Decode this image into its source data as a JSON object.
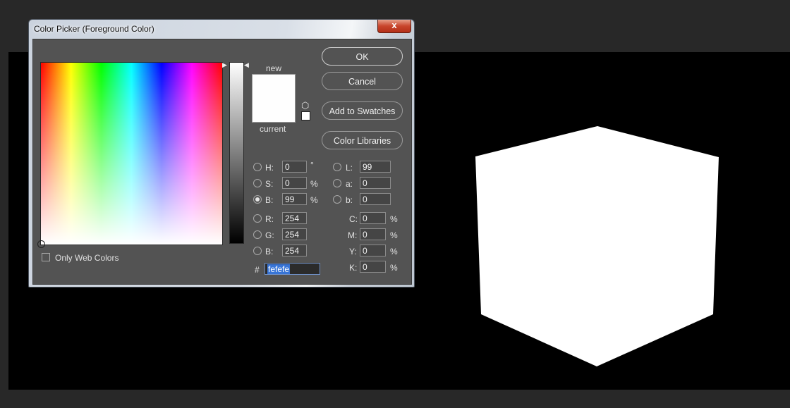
{
  "dialog": {
    "title": "Color Picker (Foreground Color)",
    "close_label": "x"
  },
  "preview": {
    "new_label": "new",
    "current_label": "current",
    "new_color": "#fefefe",
    "current_color": "#fefefe"
  },
  "buttons": {
    "ok": "OK",
    "cancel": "Cancel",
    "add_to_swatches": "Add to Swatches",
    "color_libraries": "Color Libraries"
  },
  "hsb": {
    "h": {
      "label": "H:",
      "value": "0",
      "unit": "°"
    },
    "s": {
      "label": "S:",
      "value": "0",
      "unit": "%"
    },
    "b": {
      "label": "B:",
      "value": "99",
      "unit": "%"
    }
  },
  "rgb": {
    "r": {
      "label": "R:",
      "value": "254"
    },
    "g": {
      "label": "G:",
      "value": "254"
    },
    "b": {
      "label": "B:",
      "value": "254"
    }
  },
  "lab": {
    "l": {
      "label": "L:",
      "value": "99"
    },
    "a": {
      "label": "a:",
      "value": "0"
    },
    "b": {
      "label": "b:",
      "value": "0"
    }
  },
  "cmyk": {
    "c": {
      "label": "C:",
      "value": "0",
      "unit": "%"
    },
    "m": {
      "label": "M:",
      "value": "0",
      "unit": "%"
    },
    "y": {
      "label": "Y:",
      "value": "0",
      "unit": "%"
    },
    "k": {
      "label": "K:",
      "value": "0",
      "unit": "%"
    }
  },
  "hex": {
    "label": "#",
    "value": "fefefe"
  },
  "only_web_colors": {
    "label": "Only Web Colors",
    "checked": false
  },
  "selected_mode": "B",
  "colors": {
    "chrome": "#535353",
    "canvas": "#000000",
    "cube": "#ffffff",
    "hex_highlight": "#3875d7"
  }
}
